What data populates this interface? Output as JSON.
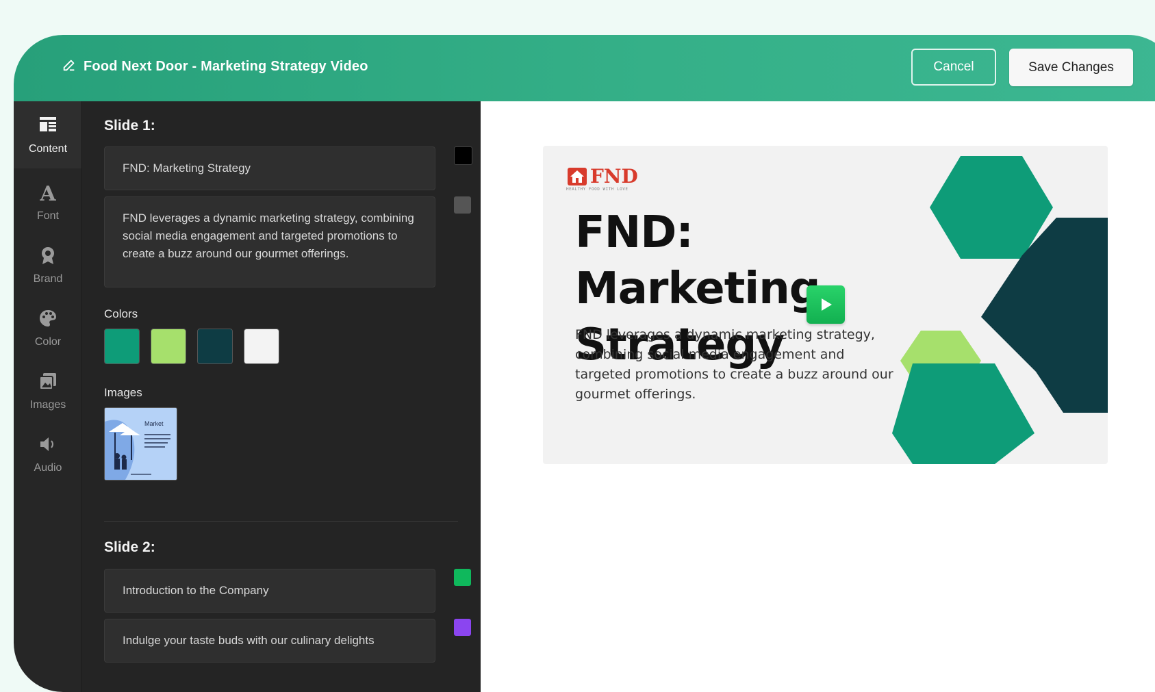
{
  "header": {
    "title": "Food Next Door - Marketing Strategy Video",
    "cancel_label": "Cancel",
    "save_label": "Save Changes"
  },
  "rail": {
    "items": [
      {
        "label": "Content",
        "icon": "content-layout-icon",
        "active": true
      },
      {
        "label": "Font",
        "icon": "font-icon"
      },
      {
        "label": "Brand",
        "icon": "brand-badge-icon"
      },
      {
        "label": "Color",
        "icon": "palette-icon"
      },
      {
        "label": "Images",
        "icon": "images-icon"
      },
      {
        "label": "Audio",
        "icon": "speaker-icon"
      }
    ]
  },
  "editor": {
    "slides": [
      {
        "title": "Slide 1:",
        "heading": "FND: Marketing Strategy",
        "heading_color": "#000000",
        "body": "FND leverages a dynamic marketing strategy, combining social media engagement and targeted promotions to create a buzz around our gourmet offerings.",
        "body_color": "#555555"
      },
      {
        "title": "Slide 2:",
        "heading": "Introduction to the Company",
        "heading_color": "#0fb85c",
        "body": "Indulge your taste buds with our culinary delights",
        "body_color": "#8b45f0"
      }
    ],
    "colors_label": "Colors",
    "colors": [
      "#0e9c78",
      "#a6e06c",
      "#0e3c44",
      "#f3f3f3"
    ],
    "images_label": "Images",
    "image_thumb": {
      "title": "Market",
      "icon": "market-illustration"
    }
  },
  "preview": {
    "logo_text": "FND",
    "logo_tagline": "HEALTHY FOOD WITH LOVE",
    "heading": "FND: Marketing Strategy",
    "body": "FND leverages a dynamic marketing strategy, combining social media engagement and targeted promotions to create a buzz around our gourmet offerings.",
    "play_icon": "play-icon",
    "accent_colors": [
      "#0e9c78",
      "#0e3c44",
      "#a6e06c"
    ]
  }
}
